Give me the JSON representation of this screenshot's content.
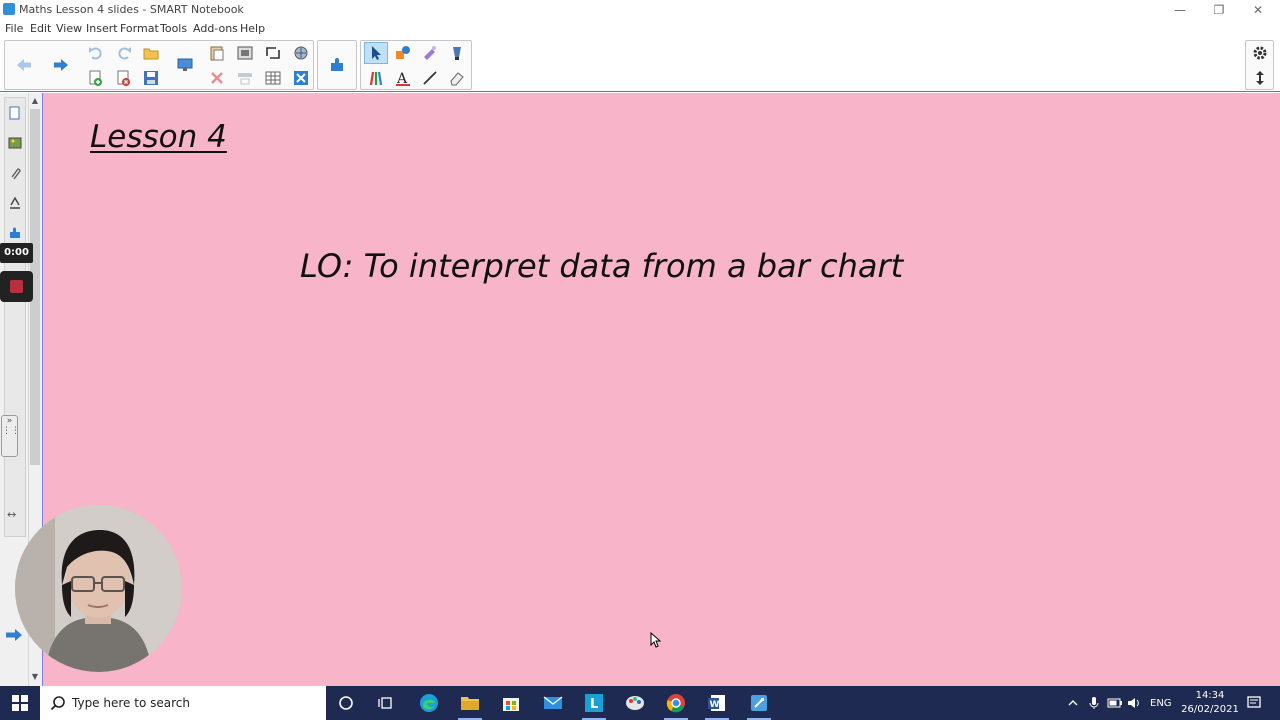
{
  "window": {
    "title": "Maths Lesson 4 slides - SMART Notebook",
    "controls": [
      "—",
      "❐",
      "✕"
    ]
  },
  "menu": [
    "File",
    "Edit",
    "View",
    "Insert",
    "Format",
    "Tools",
    "Add-ons",
    "Help"
  ],
  "toolbar": {
    "icons": [
      "back-arrow-icon",
      "forward-arrow-icon",
      "undo-icon",
      "redo-icon",
      "open-folder-icon",
      "add-page-icon",
      "delete-page-icon",
      "save-icon",
      "display-icon",
      "paste-icon",
      "screenshade-icon",
      "fullscreen-icon",
      "table-icon",
      "gallery-icon",
      "delete-icon",
      "select-icon",
      "shapes-icon",
      "magic-pen-icon",
      "fill-icon",
      "pens-icon",
      "text-icon",
      "lines-icon",
      "eraser-icon",
      "settings-icon",
      "move-toolbar-icon"
    ]
  },
  "side_panel": {
    "timer": "0:00"
  },
  "slide": {
    "title": "Lesson 4",
    "objective": "LO: To interpret data from a bar chart",
    "background": "#f8b5ca"
  },
  "taskbar": {
    "search_placeholder": "Type here to search",
    "language": "ENG",
    "time": "14:34",
    "date": "26/02/2021"
  },
  "colors": {
    "accent": "#1f2a52",
    "canvas_border": "#7d7ddc"
  }
}
